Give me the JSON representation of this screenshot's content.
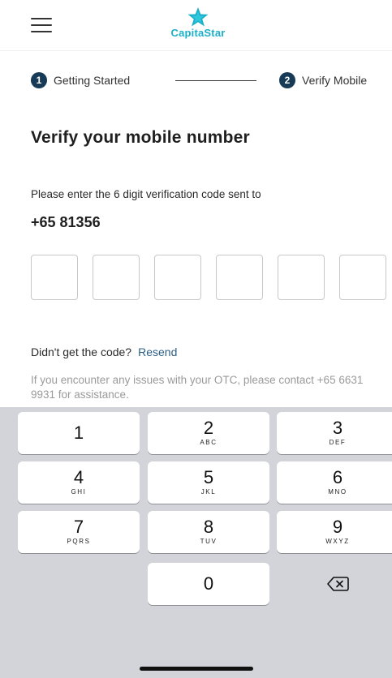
{
  "header": {
    "menu_icon": "hamburger-menu-icon",
    "logo_icon": "star-logo-icon",
    "logo_text": "CapitaStar",
    "brand_color": "#1bb0c9"
  },
  "stepper": {
    "steps": [
      {
        "number": "1",
        "label": "Getting Started"
      },
      {
        "number": "2",
        "label": "Verify Mobile"
      }
    ]
  },
  "main": {
    "title": "Verify your mobile number",
    "instruction": "Please enter the 6 digit verification code sent to",
    "phone": "+65 81356",
    "otp_digits": [
      "",
      "",
      "",
      "",
      "",
      ""
    ],
    "no_code_text": "Didn't get the code?",
    "resend_label": "Resend",
    "help_text": "If you encounter any issues with your OTC, please contact +65 6631 9931 for assistance."
  },
  "keypad": {
    "keys": [
      {
        "digit": "1",
        "letters": ""
      },
      {
        "digit": "2",
        "letters": "ABC"
      },
      {
        "digit": "3",
        "letters": "DEF"
      },
      {
        "digit": "4",
        "letters": "GHI"
      },
      {
        "digit": "5",
        "letters": "JKL"
      },
      {
        "digit": "6",
        "letters": "MNO"
      },
      {
        "digit": "7",
        "letters": "PQRS"
      },
      {
        "digit": "8",
        "letters": "TUV"
      },
      {
        "digit": "9",
        "letters": "WXYZ"
      },
      {
        "digit": "0",
        "letters": ""
      }
    ],
    "backspace_icon": "backspace-icon"
  },
  "colors": {
    "step_badge": "#173a56",
    "link": "#2c5f86",
    "keypad_bg": "#d2d4d9"
  }
}
